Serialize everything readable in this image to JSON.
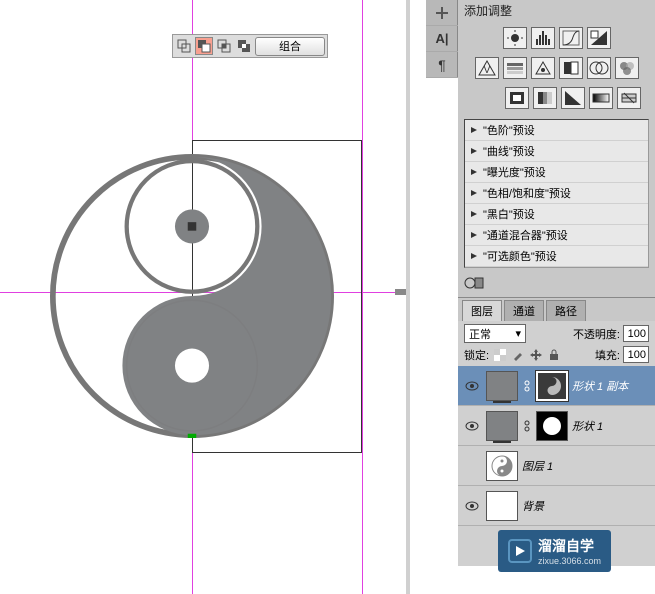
{
  "adjustments": {
    "title": "添加调整"
  },
  "floating_toolbar": {
    "combine": "组合"
  },
  "presets": [
    "\"色阶\"预设",
    "\"曲线\"预设",
    "\"曝光度\"预设",
    "\"色相/饱和度\"预设",
    "\"黑白\"预设",
    "\"通道混合器\"预设",
    "\"可选颜色\"预设"
  ],
  "tabs": {
    "layers": "图层",
    "channels": "通道",
    "paths": "路径"
  },
  "layer_opts": {
    "blend": "正常",
    "opacity_label": "不透明度:",
    "opacity_val": "100",
    "lock_label": "锁定:",
    "fill_label": "填充:",
    "fill_val": "100"
  },
  "layers": {
    "shape1copy": "形状 1 副本",
    "shape1": "形状 1",
    "layer1": "图层 1",
    "background": "背景"
  },
  "watermark": {
    "text": "溜溜自学",
    "url": "zixue.3066.com"
  }
}
